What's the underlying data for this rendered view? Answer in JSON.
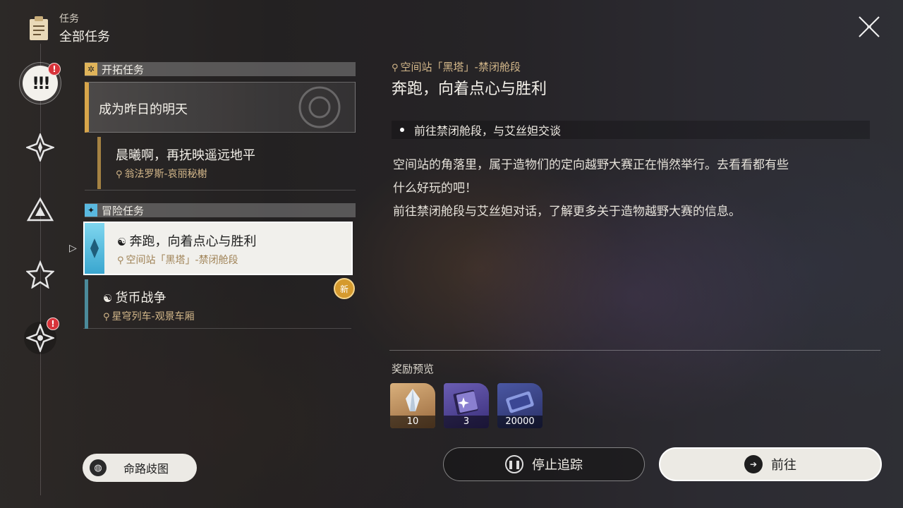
{
  "header": {
    "subtitle": "任务",
    "title": "全部任务",
    "icon": "clipboard-icon"
  },
  "rail": {
    "badge": "!",
    "active_glyph": "!!!"
  },
  "sections": {
    "trailblaze": "开拓任务",
    "adventure": "冒险任务"
  },
  "quests": {
    "main": {
      "title": "成为昨日的明天"
    },
    "sub": {
      "title": "晨曦啊，再抚映遥远地平",
      "location": "翁法罗斯-哀丽秘榭"
    },
    "selected": {
      "title": "奔跑，向着点心与胜利",
      "location": "空间站「黑塔」-禁闭舱段"
    },
    "other": {
      "title": "货币战争",
      "location": "星穹列车-观景车厢",
      "badge": "新"
    }
  },
  "route_button": "命路歧图",
  "detail": {
    "location": "空间站「黑塔」-禁闭舱段",
    "title": "奔跑，向着点心与胜利",
    "objective": "前往禁闭舱段，与艾丝妲交谈",
    "desc_line1": "空间站的角落里，属于造物们的定向越野大赛正在悄然举行。去看看都有些",
    "desc_line2": "什么好玩的吧！",
    "desc_line3": "前往禁闭舱段与艾丝妲对话，了解更多关于造物越野大赛的信息。"
  },
  "rewards": {
    "label": "奖励预览",
    "items": [
      {
        "icon": "crystal-icon",
        "count": "10"
      },
      {
        "icon": "book-icon",
        "count": "3"
      },
      {
        "icon": "credit-icon",
        "count": "20000"
      }
    ]
  },
  "buttons": {
    "stop": "停止追踪",
    "go": "前往"
  },
  "colors": {
    "gold": "#d8a54a",
    "cyan": "#3aa6cf",
    "badge_red": "#d8333a"
  }
}
